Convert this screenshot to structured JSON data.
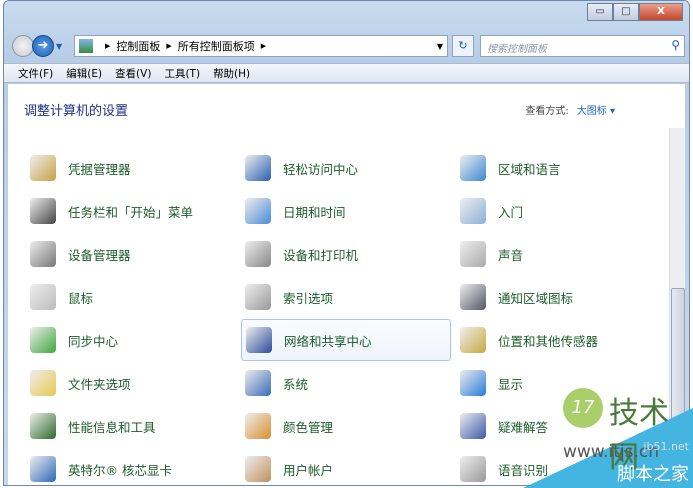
{
  "window": {
    "minimize": "▭",
    "maximize": "□",
    "close": "X"
  },
  "address": {
    "crumbs": [
      "控制面板",
      "所有控制面板项"
    ],
    "search_placeholder": "搜索控制面板"
  },
  "menu": [
    "文件(F)",
    "编辑(E)",
    "查看(V)",
    "工具(T)",
    "帮助(H)"
  ],
  "page_title": "调整计算机的设置",
  "view_by": {
    "label": "查看方式:",
    "value": "大图标 ▾"
  },
  "items": [
    [
      "凭据管理器",
      "轻松访问中心",
      "区域和语言"
    ],
    [
      "任务栏和「开始」菜单",
      "日期和时间",
      "入门"
    ],
    [
      "设备管理器",
      "设备和打印机",
      "声音"
    ],
    [
      "鼠标",
      "索引选项",
      "通知区域图标"
    ],
    [
      "同步中心",
      "网络和共享中心",
      "位置和其他传感器"
    ],
    [
      "文件夹选项",
      "系统",
      "显示"
    ],
    [
      "性能信息和工具",
      "颜色管理",
      "疑难解答"
    ],
    [
      "英特尔® 核芯显卡",
      "用户帐户",
      "语音识别"
    ]
  ],
  "icon_colors": [
    [
      "#c8a040",
      "#2a5fb0",
      "#3a8ad0"
    ],
    [
      "#444",
      "#4a8ad8",
      "#8ab0d8"
    ],
    [
      "#777",
      "#888",
      "#aaa"
    ],
    [
      "#bbb",
      "#999",
      "#556"
    ],
    [
      "#3aa83a",
      "#2a4a9a",
      "#c8a840"
    ],
    [
      "#e8c850",
      "#3a6ab8",
      "#2a7ad8"
    ],
    [
      "#2a6a2a",
      "#d89030",
      "#3a5aa8"
    ],
    [
      "#2a6ab8",
      "#c09060",
      "#999"
    ]
  ],
  "watermark": {
    "logo": "17",
    "name": "技术网",
    "url": "www.itjs.cn",
    "url2": "jb51.net",
    "site": "脚本之家"
  }
}
